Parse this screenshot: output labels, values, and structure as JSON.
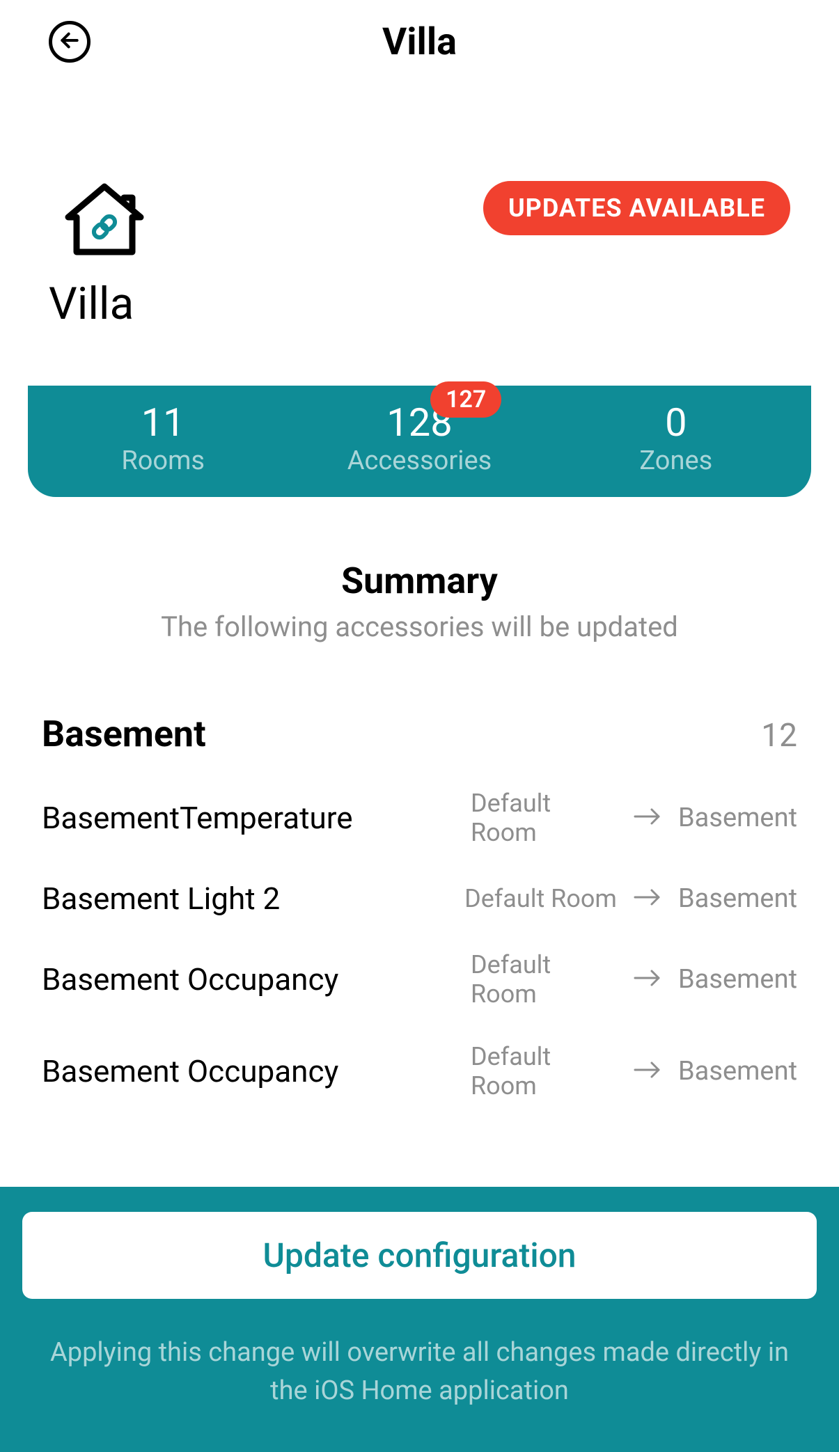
{
  "header": {
    "title": "Villa"
  },
  "home": {
    "name": "Villa",
    "updates_badge": "UPDATES AVAILABLE"
  },
  "stats": {
    "rooms": {
      "value": "11",
      "label": "Rooms"
    },
    "accessories": {
      "value": "128",
      "label": "Accessories",
      "badge": "127"
    },
    "zones": {
      "value": "0",
      "label": "Zones"
    }
  },
  "summary": {
    "title": "Summary",
    "subtitle": "The following accessories will be updated"
  },
  "section": {
    "title": "Basement",
    "count": "12",
    "items": [
      {
        "name": "BasementTemperature",
        "from": "Default Room",
        "to": "Basement"
      },
      {
        "name": "Basement Light 2",
        "from": "Default Room",
        "to": "Basement"
      },
      {
        "name": "Basement Occupancy",
        "from": "Default Room",
        "to": "Basement"
      },
      {
        "name": "Basement Occupancy",
        "from": "Default Room",
        "to": "Basement"
      }
    ]
  },
  "footer": {
    "button": "Update configuration",
    "note": "Applying this change will overwrite all changes made directly in the iOS Home application"
  }
}
